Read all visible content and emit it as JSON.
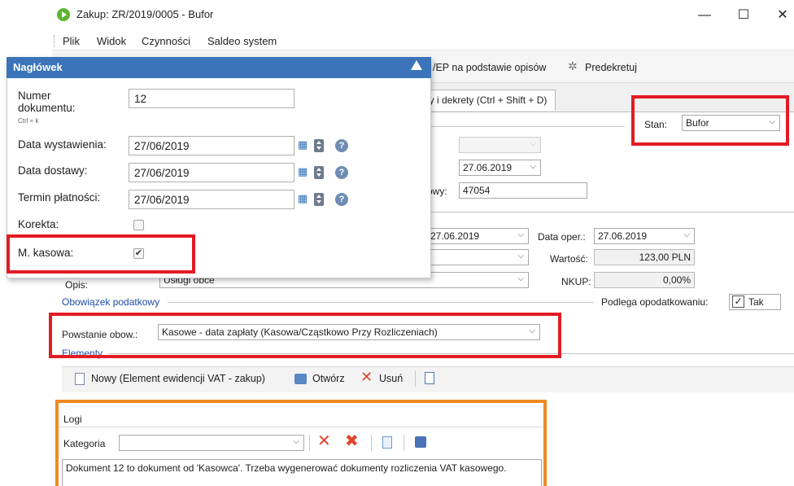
{
  "window": {
    "title": "Zakup: ZR/2019/0005 - Bufor",
    "minimize": "—",
    "maximize": "☐",
    "close": "✕"
  },
  "menu": [
    "Plik",
    "Widok",
    "Czynności",
    "Saldeo system"
  ],
  "toolbar": {
    "generate_label": "/EP na podstawie opisów",
    "predekretuj_label": "Predekretuj"
  },
  "tab": {
    "label": "ny i dekrety (Ctrl + Shift + D)"
  },
  "stan": {
    "label": "Stan:",
    "value": "Bufor"
  },
  "form": {
    "date1": "27.06.2019",
    "nr_label": "owy:",
    "nr_value": "47054",
    "date2": "27.06.2019",
    "data_oper_label": "Data oper.:",
    "data_oper_value": "27.06.2019",
    "wartosc_label": "Wartość:",
    "wartosc_value": "123,00 PLN",
    "nkup_label": "NKUP:",
    "nkup_value": "0,00%",
    "opis_label": "Opis:",
    "opis_value": "Usługi obce"
  },
  "obowiazek": {
    "section_label": "Obowiązek podatkowy",
    "podlega_label": "Podlega opodatkowaniu:",
    "tak_label": "Tak",
    "tak_checked": "✓",
    "powstanie_label": "Powstanie obow.:",
    "powstanie_value": "Kasowe - data zapłaty (Kasowa/Cząstkowo Przy Rozliczeniach)"
  },
  "elementy": {
    "section_label": "Elementy",
    "new_label": "Nowy (Element ewidencji VAT - zakup)",
    "open_label": "Otwórz",
    "delete_label": "Usuń"
  },
  "naglowek": {
    "title": "Nagłówek",
    "numer_label_1": "Numer",
    "numer_label_2": "dokumentu:",
    "numer_hint": "Ctrl + k",
    "numer_value": "12",
    "data_wyst_label": "Data wystawienia:",
    "data_wyst_value": "27/06/2019",
    "data_dost_label": "Data dostawy:",
    "data_dost_value": "27/06/2019",
    "termin_label": "Termin płatności:",
    "termin_value": "27/06/2019",
    "korekta_label": "Korekta:",
    "kasowa_label": "M. kasowa:",
    "kasowa_checked": "✔",
    "help": "?"
  },
  "logi": {
    "title": "Logi",
    "kategoria_label": "Kategoria",
    "note": "Dokument 12 to dokument od 'Kasowca'. Trzeba wygenerować dokumenty rozliczenia VAT kasowego."
  },
  "colors": {
    "highlight_red": "#e31b23",
    "highlight_orange": "#f08a24",
    "panel_header": "#3b74b8",
    "link": "#1f4da8"
  }
}
